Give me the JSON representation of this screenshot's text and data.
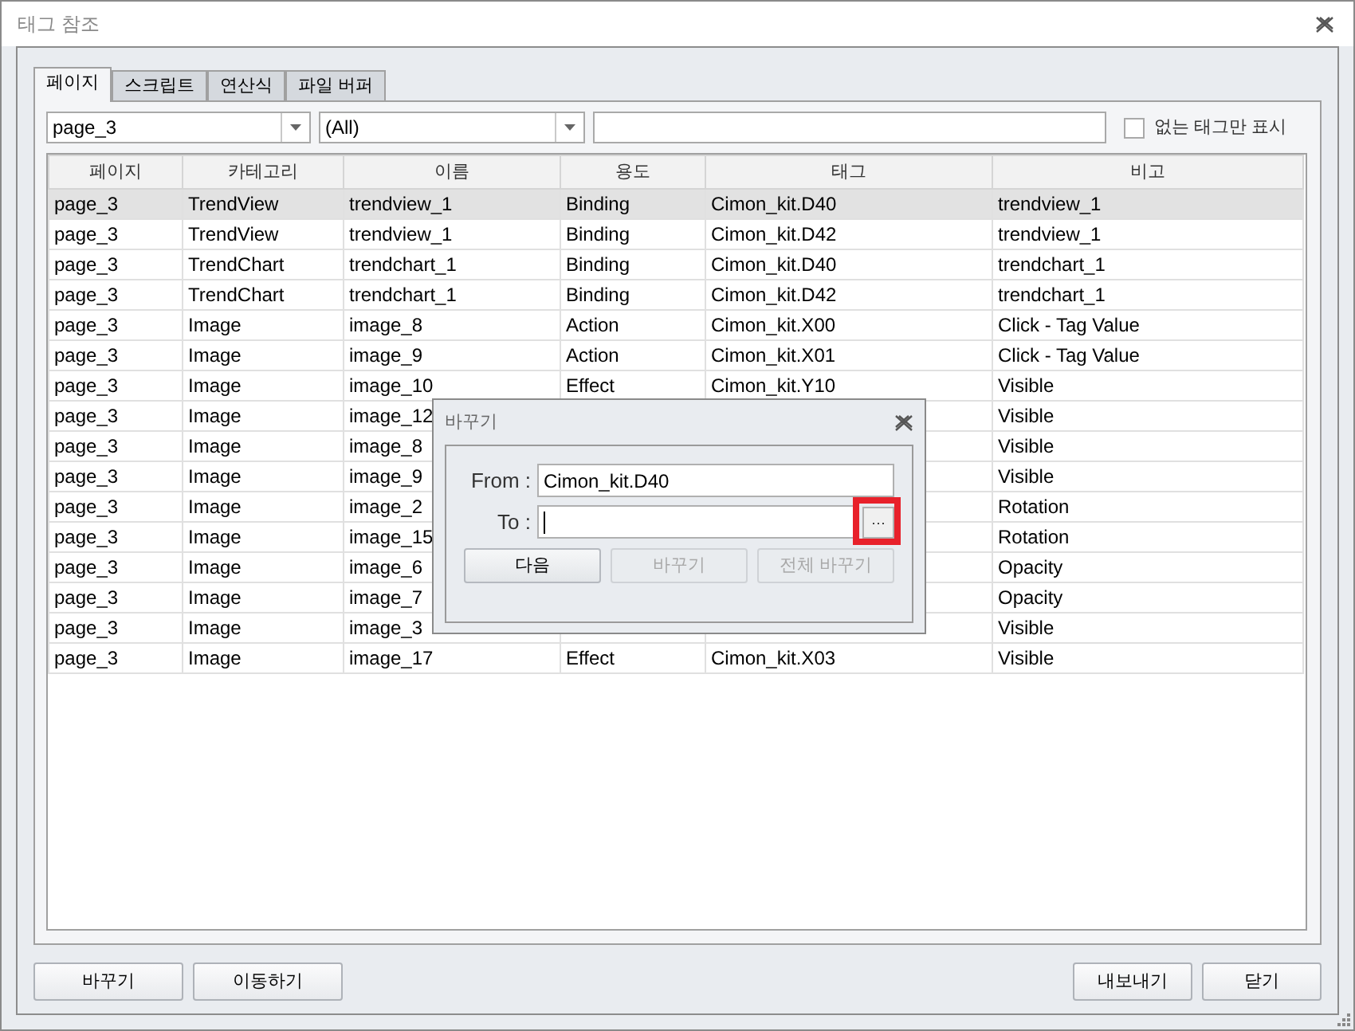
{
  "window": {
    "title": "태그 참조"
  },
  "tabs": [
    {
      "label": "페이지",
      "selected": true
    },
    {
      "label": "스크립트",
      "selected": false
    },
    {
      "label": "연산식",
      "selected": false
    },
    {
      "label": "파일 버퍼",
      "selected": false
    }
  ],
  "filters": {
    "page": "page_3",
    "category": "(All)",
    "only_missing": {
      "label": "없는 태그만 표시",
      "checked": false
    }
  },
  "table": {
    "columns": [
      "페이지",
      "카테고리",
      "이름",
      "용도",
      "태그",
      "비고"
    ],
    "rows": [
      {
        "selected": true,
        "cells": [
          "page_3",
          "TrendView",
          "trendview_1",
          "Binding",
          "Cimon_kit.D40",
          "trendview_1"
        ]
      },
      {
        "selected": false,
        "cells": [
          "page_3",
          "TrendView",
          "trendview_1",
          "Binding",
          "Cimon_kit.D42",
          "trendview_1"
        ]
      },
      {
        "selected": false,
        "cells": [
          "page_3",
          "TrendChart",
          "trendchart_1",
          "Binding",
          "Cimon_kit.D40",
          "trendchart_1"
        ]
      },
      {
        "selected": false,
        "cells": [
          "page_3",
          "TrendChart",
          "trendchart_1",
          "Binding",
          "Cimon_kit.D42",
          "trendchart_1"
        ]
      },
      {
        "selected": false,
        "cells": [
          "page_3",
          "Image",
          "image_8",
          "Action",
          "Cimon_kit.X00",
          "Click - Tag Value"
        ]
      },
      {
        "selected": false,
        "cells": [
          "page_3",
          "Image",
          "image_9",
          "Action",
          "Cimon_kit.X01",
          "Click - Tag Value"
        ]
      },
      {
        "selected": false,
        "cells": [
          "page_3",
          "Image",
          "image_10",
          "Effect",
          "Cimon_kit.Y10",
          "Visible"
        ]
      },
      {
        "selected": false,
        "cells": [
          "page_3",
          "Image",
          "image_12",
          null,
          null,
          "Visible"
        ]
      },
      {
        "selected": false,
        "cells": [
          "page_3",
          "Image",
          "image_8",
          null,
          null,
          "Visible"
        ]
      },
      {
        "selected": false,
        "cells": [
          "page_3",
          "Image",
          "image_9",
          null,
          null,
          "Visible"
        ]
      },
      {
        "selected": false,
        "cells": [
          "page_3",
          "Image",
          "image_2",
          null,
          null,
          "Rotation"
        ]
      },
      {
        "selected": false,
        "cells": [
          "page_3",
          "Image",
          "image_15",
          null,
          null,
          "Rotation"
        ]
      },
      {
        "selected": false,
        "cells": [
          "page_3",
          "Image",
          "image_6",
          null,
          null,
          "Opacity"
        ]
      },
      {
        "selected": false,
        "cells": [
          "page_3",
          "Image",
          "image_7",
          null,
          null,
          "Opacity"
        ]
      },
      {
        "selected": false,
        "cells": [
          "page_3",
          "Image",
          "image_3",
          null,
          null,
          "Visible"
        ]
      },
      {
        "selected": false,
        "cells": [
          "page_3",
          "Image",
          "image_17",
          "Effect",
          "Cimon_kit.X03",
          "Visible"
        ]
      }
    ]
  },
  "buttons_left": [
    "바꾸기",
    "이동하기"
  ],
  "buttons_right": [
    "내보내기",
    "닫기"
  ],
  "replace_dialog": {
    "title": "바꾸기",
    "from_label": "From :",
    "from_value": "Cimon_kit.D40",
    "to_label": "To :",
    "browse": {
      "label": "···",
      "highlighted": true
    },
    "buttons": [
      {
        "label": "다음",
        "disabled": false
      },
      {
        "label": "바꾸기",
        "disabled": true
      },
      {
        "label": "전체 바꾸기",
        "disabled": true
      }
    ]
  }
}
